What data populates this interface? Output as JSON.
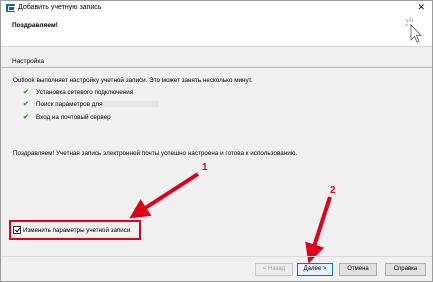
{
  "window": {
    "title": "Добавить учетную запись",
    "close_symbol": "✕"
  },
  "header": {
    "title": "Поздравляем!"
  },
  "section": {
    "title": "Настройка"
  },
  "content": {
    "intro": "Outlook выполняет настройку учетной записи. Это может занять несколько минут.",
    "steps": [
      {
        "label": "Установка сетевого подключения",
        "icon": "check-icon"
      },
      {
        "label": "Поиск параметров для",
        "icon": "check-icon"
      },
      {
        "label": "Вход на почтовый сервер",
        "icon": "check-icon"
      }
    ],
    "check_symbol": "✔",
    "success": "Поздравляем! Учетная запись электронной почты успешно настроена и готова к использованию."
  },
  "options": {
    "change_settings_label": "Изменить параметры учетной записи",
    "change_settings_checked": true
  },
  "annotations": {
    "marker1": "1",
    "marker2": "2",
    "color": "#e0001b"
  },
  "buttons": {
    "back": "< Назад",
    "next": "Далее >",
    "cancel": "Отмена",
    "help": "Справка"
  }
}
